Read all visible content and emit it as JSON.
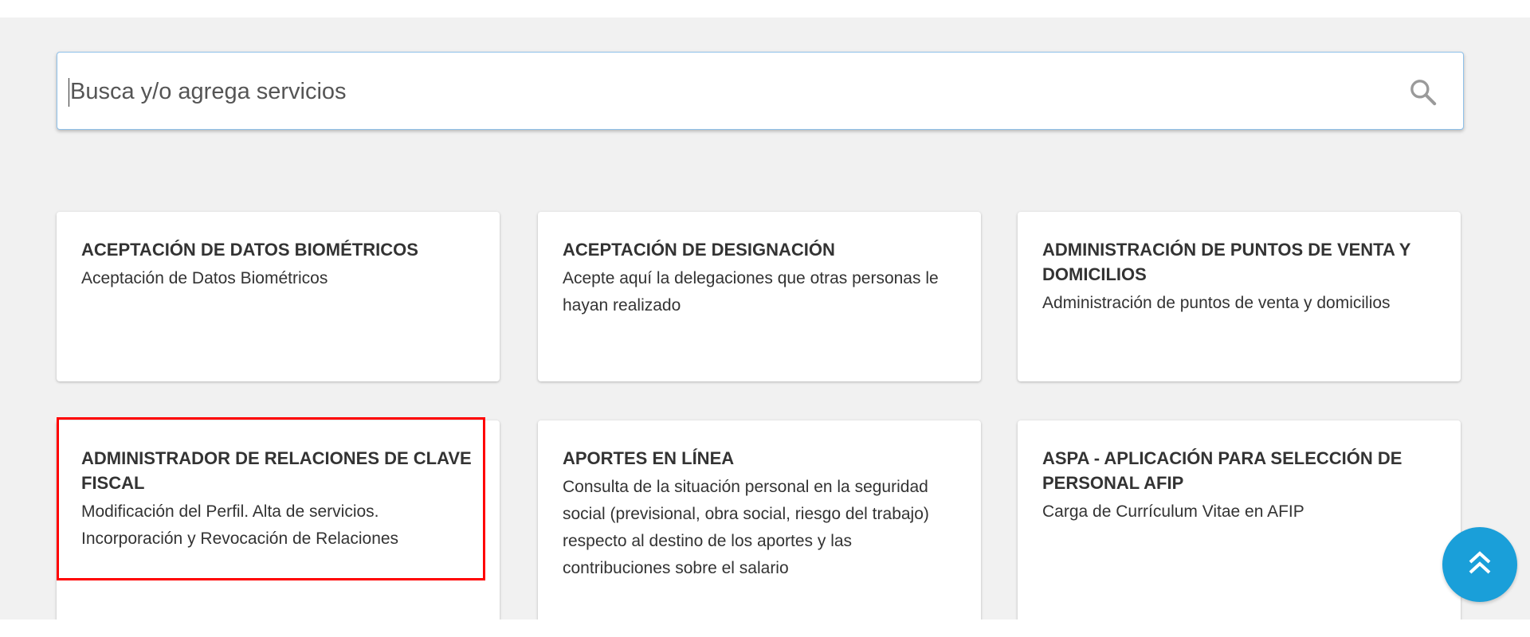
{
  "search": {
    "placeholder": "Busca y/o agrega servicios",
    "icon": "search-icon"
  },
  "cards": [
    {
      "title": "ACEPTACIÓN DE DATOS BIOMÉTRICOS",
      "description": "Aceptación de Datos Biométricos"
    },
    {
      "title": "ACEPTACIÓN DE DESIGNACIÓN",
      "description": "Acepte aquí la delegaciones que otras personas le hayan realizado"
    },
    {
      "title": "ADMINISTRACIÓN DE PUNTOS DE VENTA Y DOMICILIOS",
      "description": "Administración de puntos de venta y domicilios"
    },
    {
      "title": "ADMINISTRADOR DE RELACIONES DE CLAVE FISCAL",
      "description": "Modificación del Perfil. Alta de servicios. Incorporación y Revocación de Relaciones"
    },
    {
      "title": "APORTES EN LÍNEA",
      "description": "Consulta de la situación personal en la seguridad social (previsional, obra social, riesgo del trabajo) respecto al destino de los aportes y las contribuciones sobre el salario"
    },
    {
      "title": "ASPA - APLICACIÓN PARA SELECCIÓN DE PERSONAL AFIP",
      "description": "Carga de Currículum Vitae en AFIP"
    }
  ],
  "colors": {
    "accent": "#1a9fd9",
    "highlight": "#ff0000",
    "background": "#f1f1f1"
  },
  "fab": {
    "icon": "double-chevron-up-icon"
  }
}
